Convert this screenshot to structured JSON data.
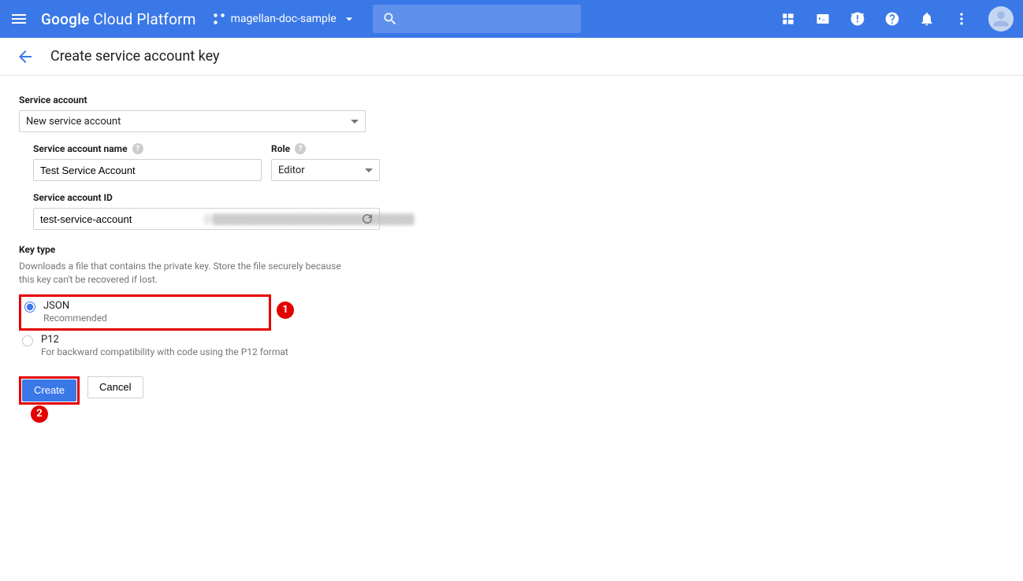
{
  "header": {
    "logo_prefix": "Google",
    "logo_rest": " Cloud Platform",
    "project_name": "magellan-doc-sample",
    "search_placeholder": ""
  },
  "subheader": {
    "title": "Create service account key"
  },
  "form": {
    "service_account_label": "Service account",
    "service_account_value": "New service account",
    "name_label": "Service account name",
    "name_value": "Test Service Account",
    "role_label": "Role",
    "role_value": "Editor",
    "id_label": "Service account ID",
    "id_value": "test-service-account",
    "id_suffix": "@",
    "keytype_label": "Key type",
    "keytype_desc": "Downloads a file that contains the private key. Store the file securely because this key can't be recovered if lost.",
    "options": {
      "json": {
        "label": "JSON",
        "desc": "Recommended"
      },
      "p12": {
        "label": "P12",
        "desc": "For backward compatibility with code using the P12 format"
      }
    },
    "create_btn": "Create",
    "cancel_btn": "Cancel"
  },
  "callouts": {
    "one": "1",
    "two": "2"
  }
}
